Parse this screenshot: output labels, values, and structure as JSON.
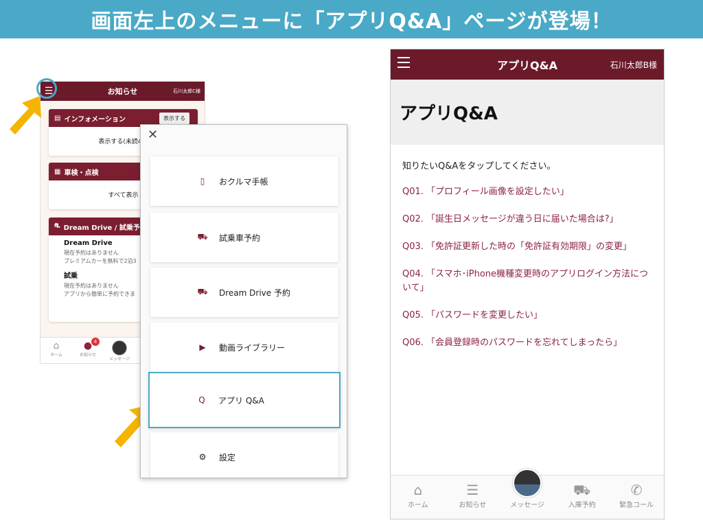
{
  "banner": {
    "text": "画面左上のメニューに「アプリQ&A」ページが登場！"
  },
  "phone_small": {
    "header": {
      "title": "お知らせ",
      "user": "石川太郎C様"
    },
    "info_card": {
      "title": "インフォメーション",
      "button": "表示する",
      "body": "表示する(未読4件"
    },
    "inspection_card": {
      "title": "車検・点検",
      "body": "すべて表示"
    },
    "dream_card": {
      "title": "Dream Drive / 試乗予",
      "sections": [
        {
          "heading": "Dream Drive",
          "line1": "現在予約はありません",
          "line2": "プレミアムカーを無料で2泊3"
        },
        {
          "heading": "試乗",
          "line1": "現在予約はありません",
          "line2": "アプリから簡単に予約できま"
        }
      ]
    },
    "tabs": [
      {
        "label": "ホーム",
        "icon": "home-icon"
      },
      {
        "label": "お知らせ",
        "icon": "chat-icon",
        "badge": "4"
      },
      {
        "label": "メッセージ",
        "icon": "avatar"
      }
    ]
  },
  "menu": {
    "close_icon": "close-icon",
    "items": [
      {
        "label": "おクルマ手帳",
        "icon": "notebook-icon"
      },
      {
        "label": "試乗車予約",
        "icon": "car-icon"
      },
      {
        "label": "Dream Drive 予約",
        "icon": "car-clock-icon"
      },
      {
        "label": "動画ライブラリー",
        "icon": "youtube-icon"
      },
      {
        "label": "アプリ Q&A",
        "icon": "qa-icon"
      },
      {
        "label": "設定",
        "icon": "gear-icon"
      }
    ]
  },
  "phone_large": {
    "header": {
      "title": "アプリQ&A",
      "user": "石川太郎B様"
    },
    "page_title": "アプリQ&A",
    "intro": "知りたいQ&Aをタップしてください。",
    "questions": [
      "Q01. 「プロフィール画像を設定したい」",
      "Q02. 「誕生日メッセージが違う日に届いた場合は?」",
      "Q03. 「免許証更新した時の「免許証有効期限」の変更」",
      "Q04. 「スマホ･iPhone機種変更時のアプリログイン方法について」",
      "Q05. 「パスワードを変更したい」",
      "Q06. 「会員登録時のパスワードを忘れてしまったら」"
    ],
    "tabs": [
      {
        "label": "ホーム",
        "icon": "home-icon"
      },
      {
        "label": "お知らせ",
        "icon": "chat-icon"
      },
      {
        "label": "メッセージ",
        "icon": "avatar"
      },
      {
        "label": "入庫予約",
        "icon": "car-icon"
      },
      {
        "label": "緊急コール",
        "icon": "phone-icon"
      }
    ]
  },
  "colors": {
    "banner": "#49a9c6",
    "header": "#6b1a2a",
    "link": "#8b2340",
    "highlight": "#49a9c6",
    "arrow": "#f5b400"
  }
}
